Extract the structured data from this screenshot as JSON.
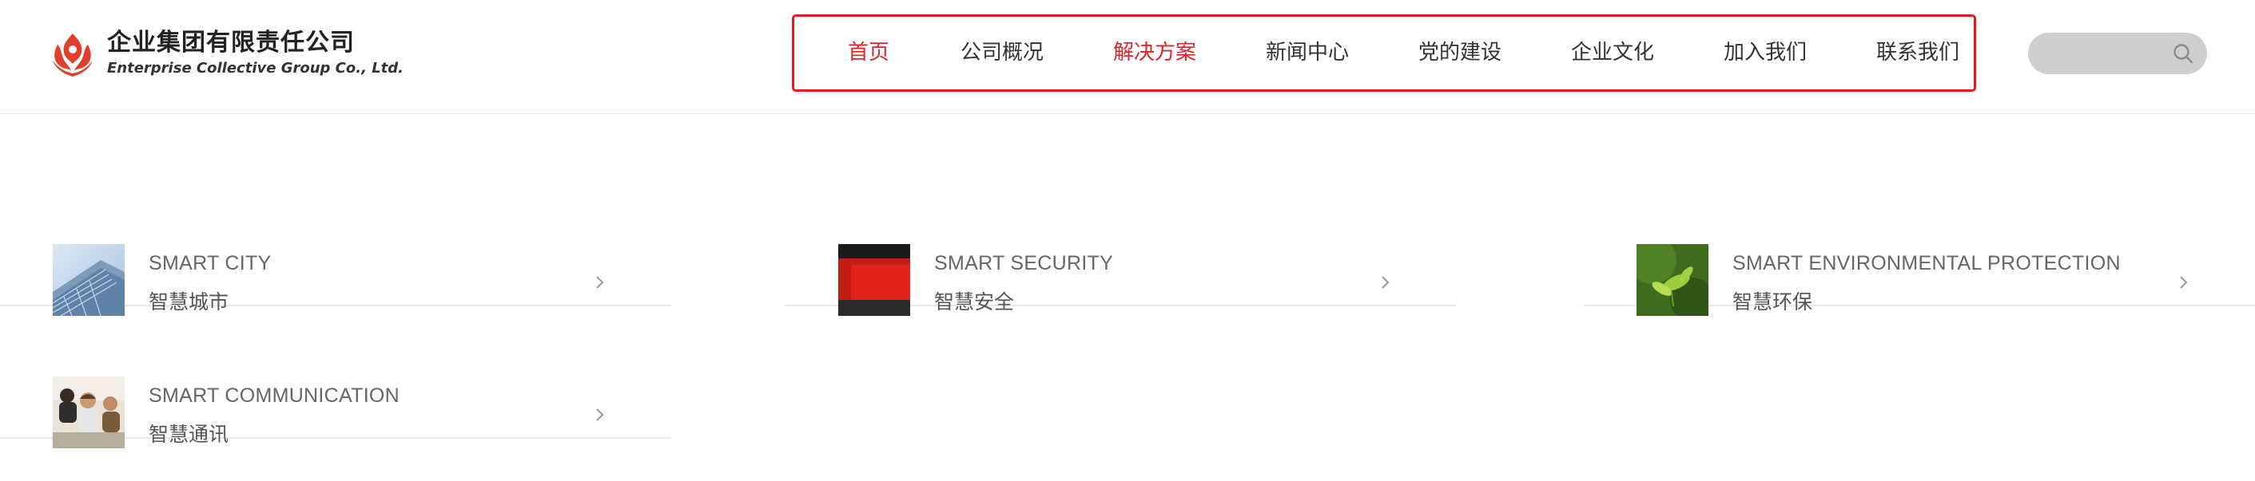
{
  "brand": {
    "name_cn": "企业集团有限责任公司",
    "name_en": "Enterprise Collective Group Co., Ltd.",
    "accent": "#e41b1b",
    "logo_color": "#e0402a"
  },
  "nav": {
    "items": [
      {
        "label": "首页",
        "active": true
      },
      {
        "label": "公司概况",
        "active": false
      },
      {
        "label": "解决方案",
        "active": true
      },
      {
        "label": "新闻中心",
        "active": false
      },
      {
        "label": "党的建设",
        "active": false
      },
      {
        "label": "企业文化",
        "active": false
      },
      {
        "label": "加入我们",
        "active": false
      },
      {
        "label": "联系我们",
        "active": false
      }
    ],
    "active_color": "#d9262b",
    "highlight_border_color": "#e41b1b"
  },
  "search": {
    "value": "",
    "placeholder": "",
    "icon": "search-icon"
  },
  "solutions": [
    {
      "en": "SMART CITY",
      "cn": "智慧城市",
      "thumb": "city-building-photo",
      "icon": "chevron-right-icon"
    },
    {
      "en": "SMART SECURITY",
      "cn": "智慧安全",
      "thumb": "red-security-panel-photo",
      "icon": "chevron-right-icon"
    },
    {
      "en": "SMART ENVIRONMENTAL PROTECTION",
      "cn": "智慧环保",
      "thumb": "green-leaf-photo",
      "icon": "chevron-right-icon"
    },
    {
      "en": "SMART COMMUNICATION",
      "cn": "智慧通讯",
      "thumb": "call-center-photo",
      "icon": "chevron-right-icon"
    }
  ]
}
